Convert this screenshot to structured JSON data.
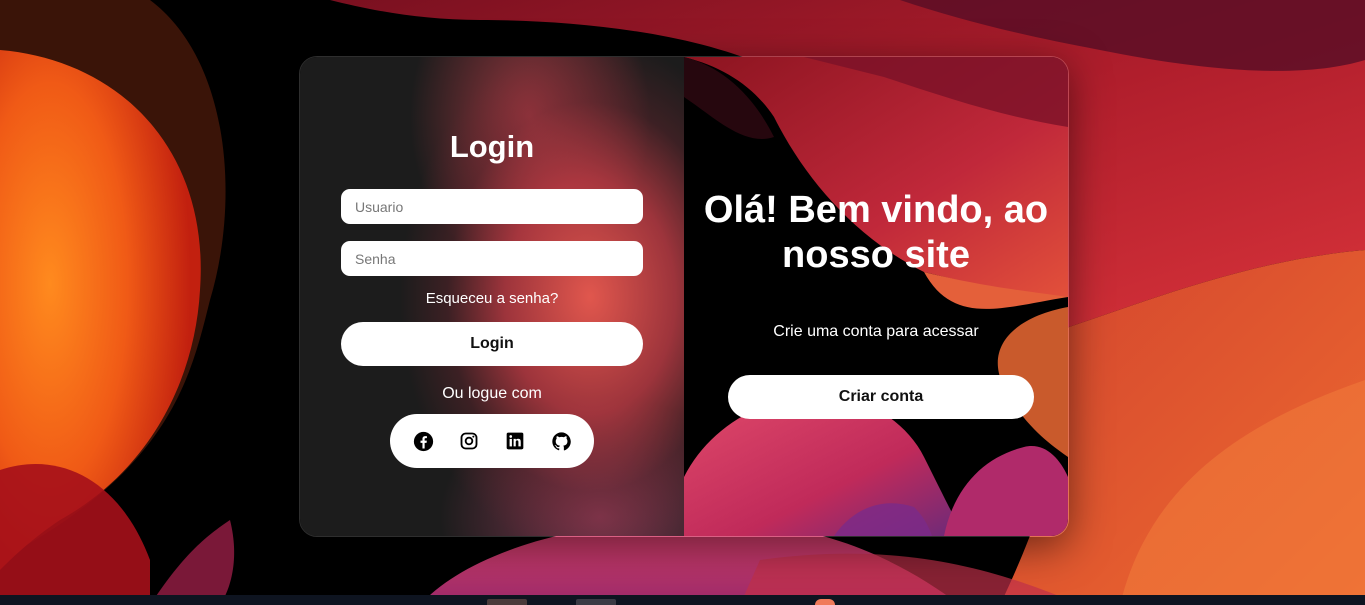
{
  "login_panel": {
    "title": "Login",
    "username_placeholder": "Usuario",
    "password_placeholder": "Senha",
    "forgot_password": "Esqueceu a senha?",
    "login_button": "Login",
    "social_prompt": "Ou logue com",
    "social_icons": [
      "facebook-icon",
      "instagram-icon",
      "linkedin-icon",
      "github-icon"
    ]
  },
  "welcome_panel": {
    "heading": "Olá! Bem vindo, ao nosso site",
    "subtitle": "Crie uma conta para acessar",
    "create_button": "Criar conta"
  },
  "colors": {
    "accent_orange": "#f26a2e",
    "accent_red": "#c0283a",
    "accent_pink": "#d8347a",
    "button_bg": "#ffffff"
  }
}
